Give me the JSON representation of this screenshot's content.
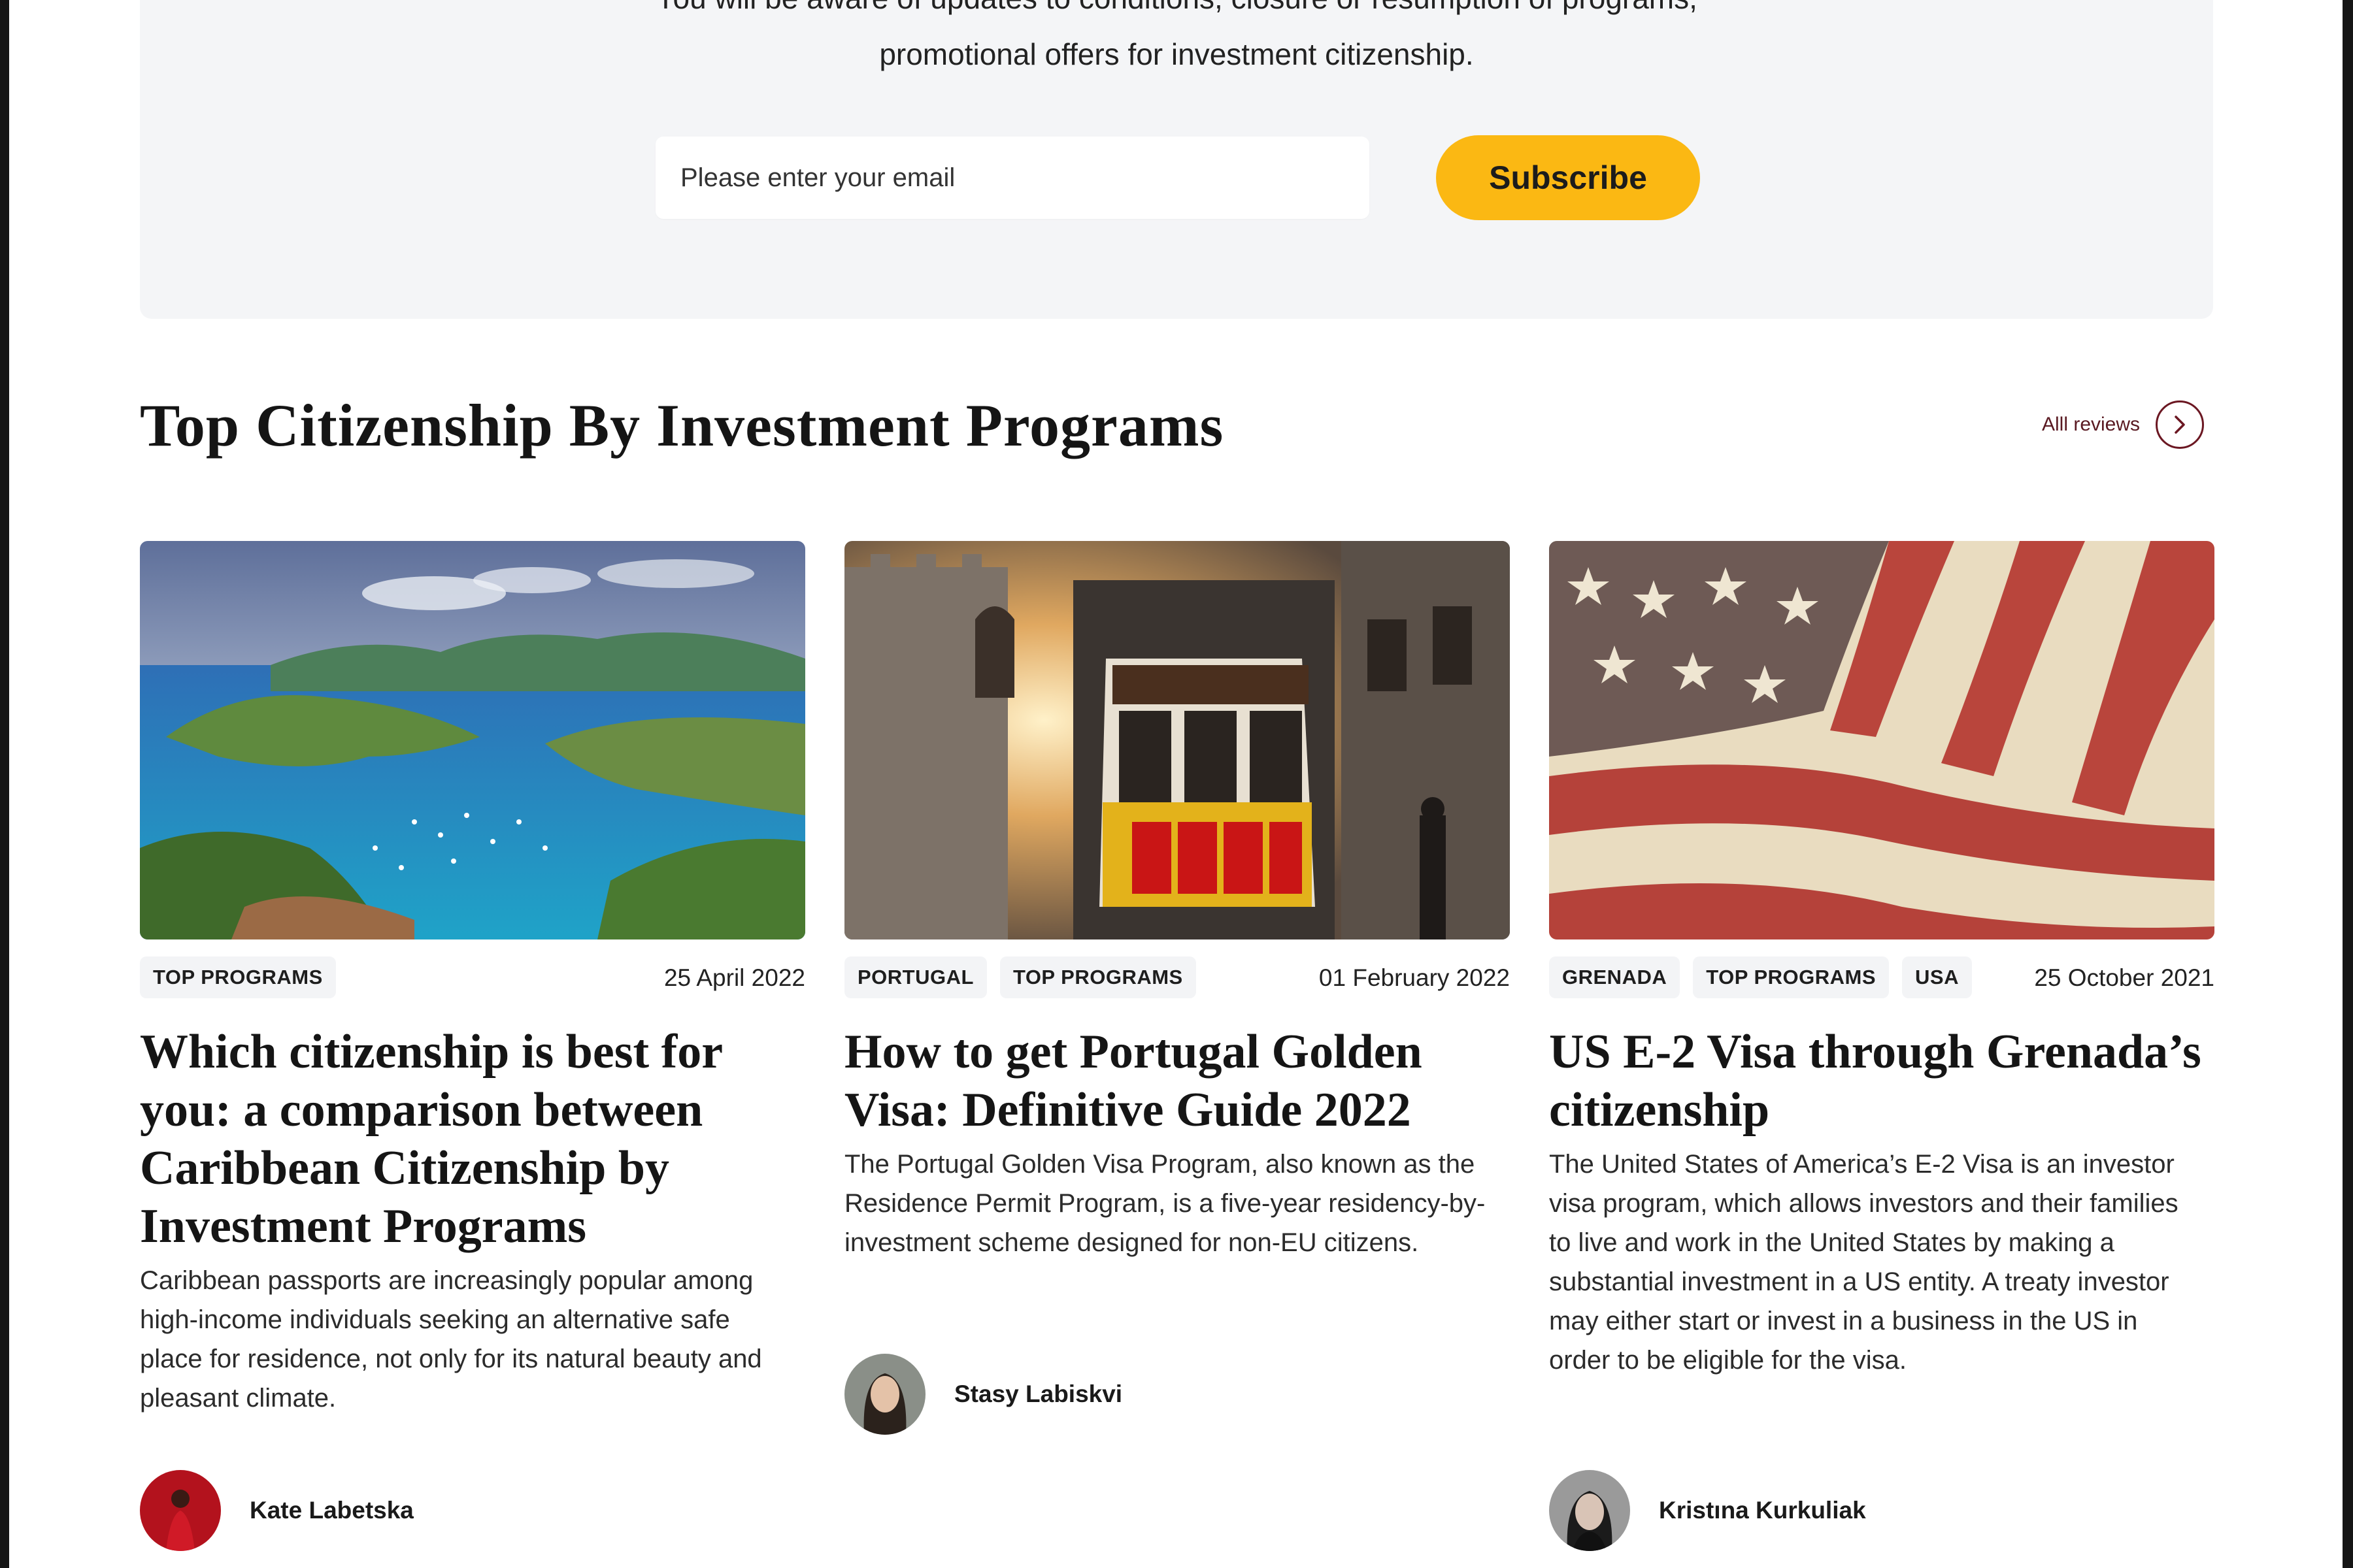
{
  "newsletter": {
    "line1": "You will be aware of updates to conditions, closure or resumption of programs,",
    "line2": "promotional offers for investment citizenship.",
    "email_placeholder": "Please enter your email",
    "subscribe_label": "Subscribe"
  },
  "section": {
    "title": "Top Citizenship By Investment Programs",
    "all_reviews_label": "Alll reviews",
    "all_reviews_icon": "chevron-right-icon"
  },
  "cards": [
    {
      "tags": [
        "TOP PROGRAMS"
      ],
      "date": "25 April 2022",
      "title": "Which citizenship is best for you: a comparison between Caribbean Citizenship by Investment Programs",
      "excerpt": "Caribbean passports are increasingly popular among high-income individuals seeking an alternative safe place for residence, not only for its natural beauty and pleasant climate.",
      "author": "Kate Labetska"
    },
    {
      "tags": [
        "PORTUGAL",
        "TOP PROGRAMS"
      ],
      "date": "01 February 2022",
      "title": "How to get Portugal Golden Visa: Definitive Guide 2022",
      "excerpt": "The Portugal Golden Visa Program, also known as the Residence Permit Program, is a five-year residency-by-investment scheme designed for non-EU citizens.",
      "author": "Stasy Labiskvi"
    },
    {
      "tags": [
        "GRENADA",
        "TOP PROGRAMS",
        "USA"
      ],
      "date": "25 October 2021",
      "title": "US E-2 Visa through Grenada’s citizenship",
      "excerpt": "The United States of America’s E-2 Visa is an investor visa program, which allows investors and their families to live and work in the United States by making a substantial investment in a US entity. A treaty investor may either start or invest in a business in the US in order to be eligible for the visa.",
      "author": "Kristına Kurkuliak"
    }
  ],
  "colors": {
    "accent": "#fbb813",
    "link": "#5a1a22",
    "panel_bg": "#f4f5f7",
    "tag_bg": "#f3f4f6"
  }
}
